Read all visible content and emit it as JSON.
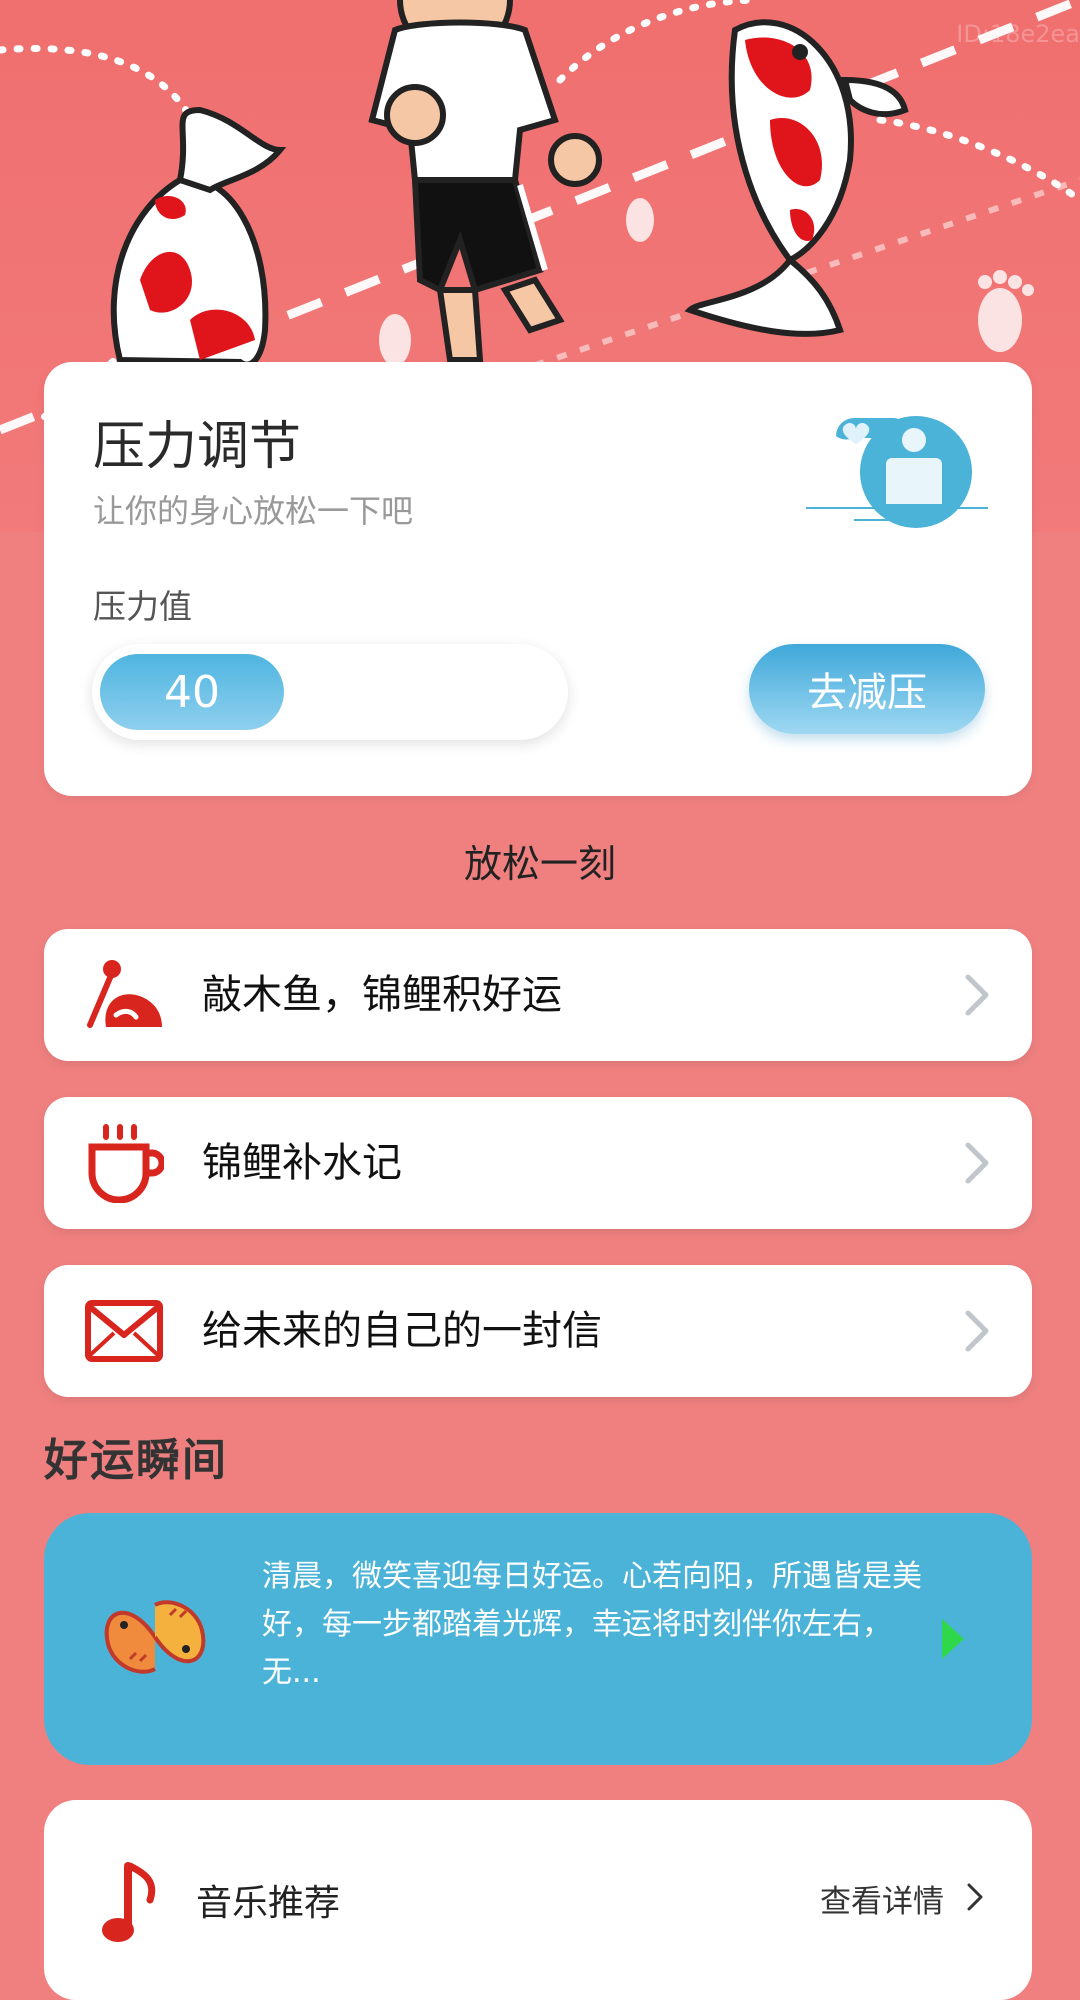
{
  "watermark": "ID:18e2ea",
  "stress": {
    "title": "压力调节",
    "subtitle": "让你的身心放松一下吧",
    "label": "压力值",
    "value": "40",
    "button": "去减压"
  },
  "relax": {
    "section_title": "放松一刻",
    "items": [
      {
        "label": "敲木鱼，锦鲤积好运",
        "icon": "wooden-fish-icon"
      },
      {
        "label": "锦鲤补水记",
        "icon": "cup-icon"
      },
      {
        "label": "给未来的自己的一封信",
        "icon": "envelope-icon"
      }
    ]
  },
  "luck": {
    "title": "好运瞬间",
    "text": "清晨，微笑喜迎每日好运。心若向阳，所遇皆是美好，每一步都踏着光辉，幸运将时刻伴你左右，无..."
  },
  "music": {
    "label": "音乐推荐",
    "more": "查看详情"
  },
  "colors": {
    "background": "#f08080",
    "accent_blue": "#4cb3d8",
    "icon_red": "#d8261e",
    "play_green": "#2fd84a"
  }
}
